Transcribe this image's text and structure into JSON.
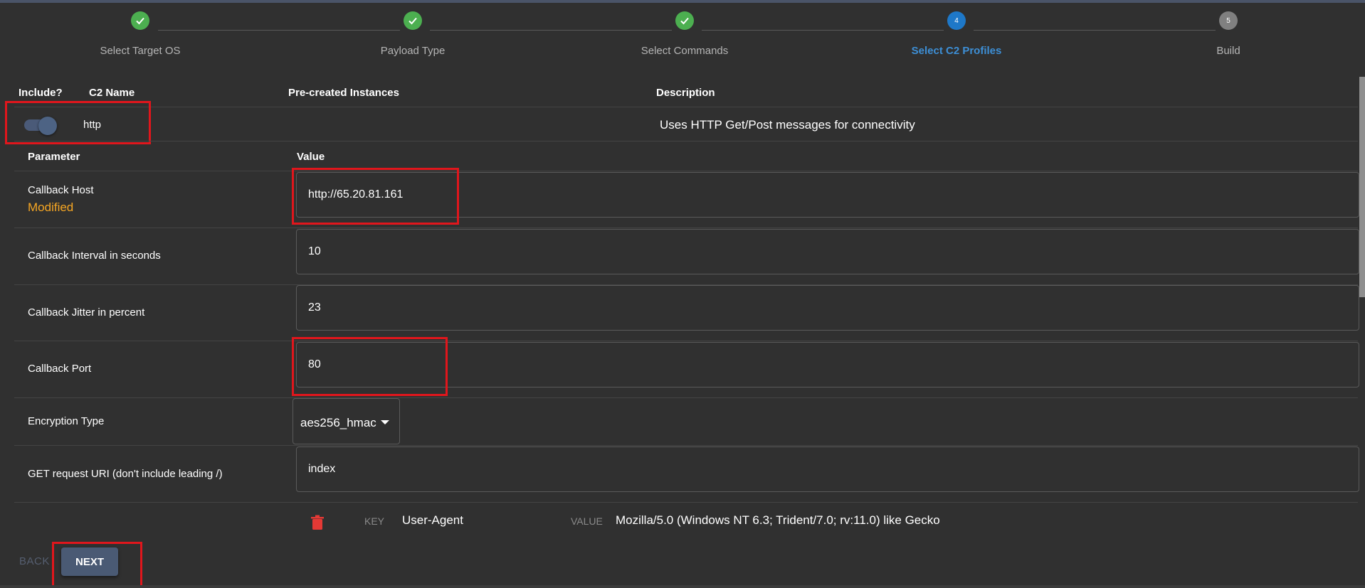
{
  "stepper": {
    "steps": [
      {
        "label": "Select Target OS",
        "state": "done",
        "number": "1"
      },
      {
        "label": "Payload Type",
        "state": "done",
        "number": "2"
      },
      {
        "label": "Select Commands",
        "state": "done",
        "number": "3"
      },
      {
        "label": "Select C2 Profiles",
        "state": "active",
        "number": "4"
      },
      {
        "label": "Build",
        "state": "todo",
        "number": "5"
      }
    ]
  },
  "table": {
    "headers": {
      "include": "Include?",
      "c2_name": "C2 Name",
      "instances": "Pre-created Instances",
      "description": "Description"
    },
    "profile": {
      "name": "http",
      "description": "Uses HTTP Get/Post messages for connectivity",
      "included": true
    }
  },
  "params": {
    "header_parameter": "Parameter",
    "header_value": "Value",
    "callback_host": {
      "label": "Callback Host",
      "status": "Modified",
      "value": "http://65.20.81.161"
    },
    "callback_interval": {
      "label": "Callback Interval in seconds",
      "value": "10"
    },
    "callback_jitter": {
      "label": "Callback Jitter in percent",
      "value": "23"
    },
    "callback_port": {
      "label": "Callback Port",
      "value": "80"
    },
    "encryption_type": {
      "label": "Encryption Type",
      "value": "aes256_hmac"
    },
    "get_uri": {
      "label": "GET request URI (don't include leading /)",
      "value": "index"
    },
    "header_row": {
      "key_label": "KEY",
      "key": "User-Agent",
      "value_label": "VALUE",
      "value": "Mozilla/5.0 (Windows NT 6.3; Trident/7.0; rv:11.0) like Gecko"
    }
  },
  "actions": {
    "back": "BACK",
    "next": "NEXT"
  },
  "colors": {
    "background": "#303030",
    "done": "#4caf50",
    "active": "#1e78c8",
    "modified": "#f5a623",
    "highlight": "#e0161c"
  }
}
